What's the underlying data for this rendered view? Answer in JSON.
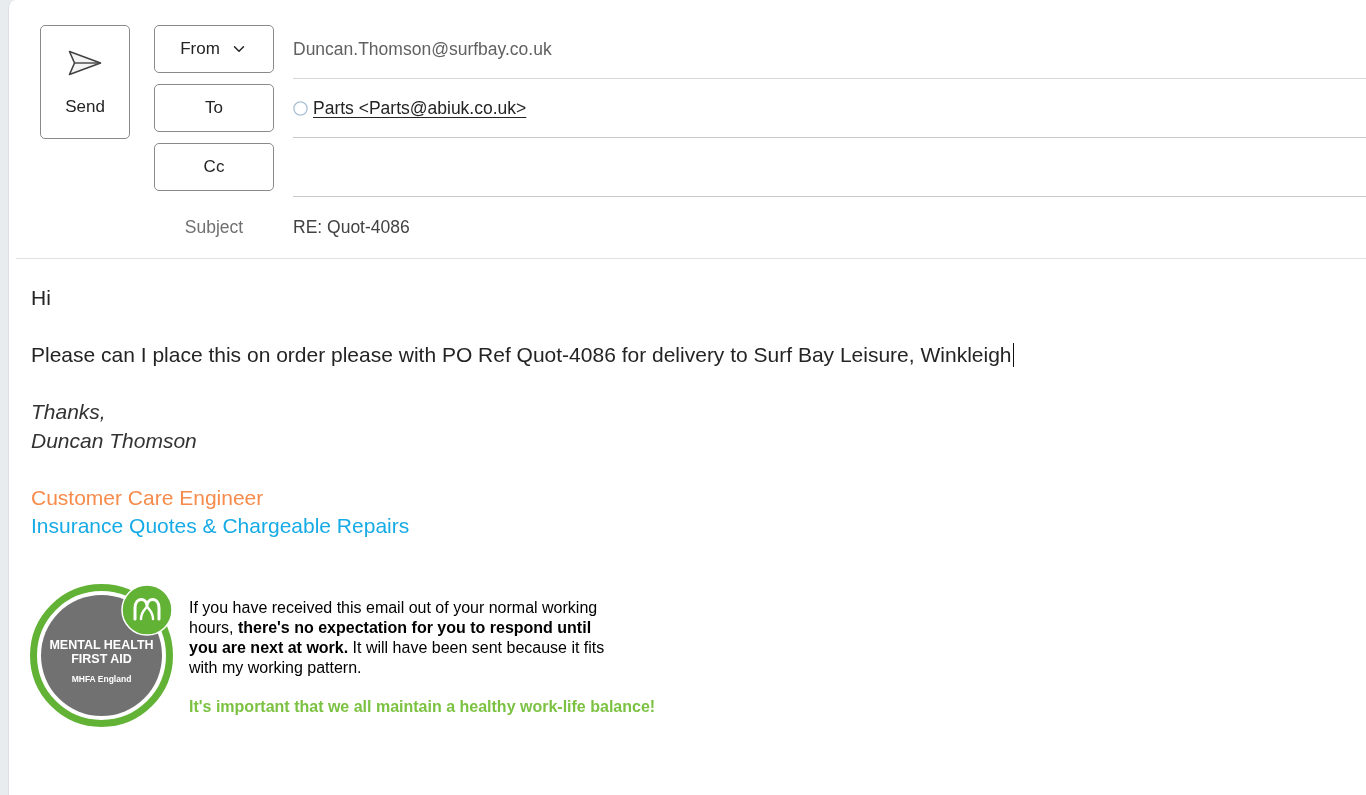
{
  "compose": {
    "send_button": {
      "label": "Send"
    },
    "from": {
      "label": "From",
      "value": "Duncan.Thomson@surfbay.co.uk"
    },
    "to": {
      "label": "To",
      "recipients": [
        "Parts <Parts@abiuk.co.uk>"
      ]
    },
    "cc": {
      "label": "Cc"
    },
    "subject": {
      "label": "Subject",
      "value": "RE: Quot-4086"
    }
  },
  "body": {
    "greeting": "Hi",
    "message": {
      "text": "Please can I place this on order please with PO Ref Quot-4086 for delivery to Surf Bay Leisure, Winkleigh",
      "caret": true
    },
    "closing": [
      "Thanks,",
      "Duncan Thomson"
    ],
    "job_title": "Customer Care Engineer",
    "department": "Insurance Quotes & Chargeable Repairs",
    "badge": {
      "title": "MENTAL HEALTH FIRST AID",
      "subtitle": "MHFA England"
    },
    "notice": "If you have received this email out of your normal working hours, **there's no expectation for you to respond until you are next at work.** It will have been sent because it fits with my working pattern.",
    "tagline": "It's important that we all maintain a healthy work-life balance!"
  }
}
